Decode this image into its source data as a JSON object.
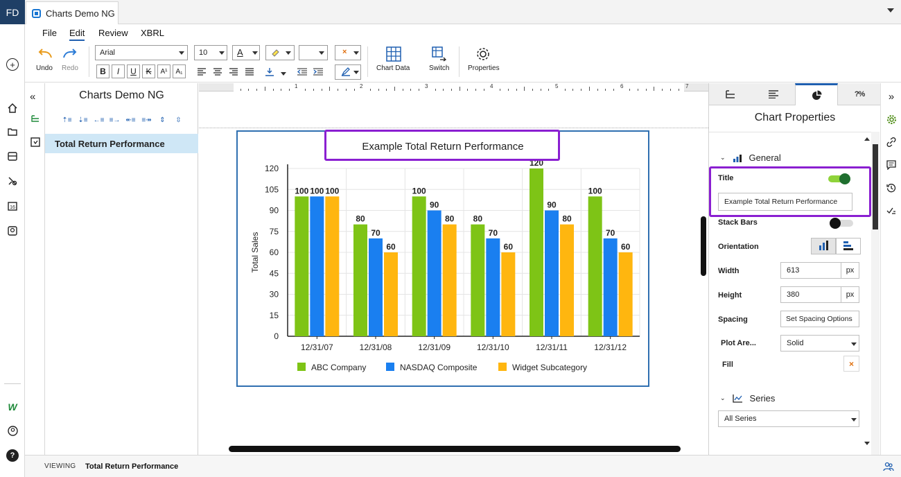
{
  "app": {
    "logo": "FD",
    "tab_title": "Charts Demo NG"
  },
  "menu": [
    "File",
    "Edit",
    "Review",
    "XBRL"
  ],
  "ribbon": {
    "undo": "Undo",
    "redo": "Redo",
    "font_family": "Arial",
    "font_size": "10",
    "chart_data": "Chart Data",
    "switch": "Switch",
    "properties": "Properties",
    "bold": "B",
    "italic": "I",
    "underline": "U",
    "strike": "K",
    "superscript": "A¹",
    "subscript": "A₁",
    "font_color_glyph": "A"
  },
  "outline": {
    "title": "Charts Demo NG",
    "selected_item": "Total Return Performance"
  },
  "ruler_numbers": [
    "1",
    "2",
    "3",
    "4",
    "5",
    "6",
    "7"
  ],
  "chart_data": {
    "type": "bar",
    "title": "Example Total Return Performance",
    "ylabel": "Total Sales",
    "xlabel": "",
    "categories": [
      "12/31/07",
      "12/31/08",
      "12/31/09",
      "12/31/10",
      "12/31/11",
      "12/31/12"
    ],
    "series": [
      {
        "name": "ABC Company",
        "color": "#7ec416",
        "values": [
          100,
          80,
          100,
          80,
          120,
          100
        ]
      },
      {
        "name": "NASDAQ Composite",
        "color": "#1a7ff0",
        "values": [
          100,
          70,
          90,
          70,
          90,
          70
        ]
      },
      {
        "name": "Widget Subcategory",
        "color": "#ffb60f",
        "values": [
          100,
          60,
          80,
          60,
          80,
          60
        ]
      }
    ],
    "yticks": [
      0,
      15,
      30,
      45,
      60,
      75,
      90,
      105,
      120
    ],
    "ylim": [
      0,
      120
    ],
    "grid": true,
    "legend": "bottom"
  },
  "properties": {
    "panel_title": "Chart Properties",
    "general": "General",
    "title_label": "Title",
    "title_value": "Example Total Return Performance",
    "title_toggle_on": true,
    "stack_bars_label": "Stack Bars",
    "stack_bars_on": false,
    "orientation_label": "Orientation",
    "width_label": "Width",
    "width_value": "613",
    "width_unit": "px",
    "height_label": "Height",
    "height_value": "380",
    "height_unit": "px",
    "spacing_label": "Spacing",
    "spacing_button": "Set Spacing Options",
    "plot_area_label": "Plot Are...",
    "plot_area_value": "Solid",
    "fill_label": "Fill",
    "series_section": "Series",
    "series_select": "All Series"
  },
  "status": {
    "label": "VIEWING",
    "value": "Total Return Performance"
  },
  "colors": {
    "accent": "#1f5fb0",
    "highlight": "#8a1fd1",
    "toggle_on": "#7ec416"
  }
}
